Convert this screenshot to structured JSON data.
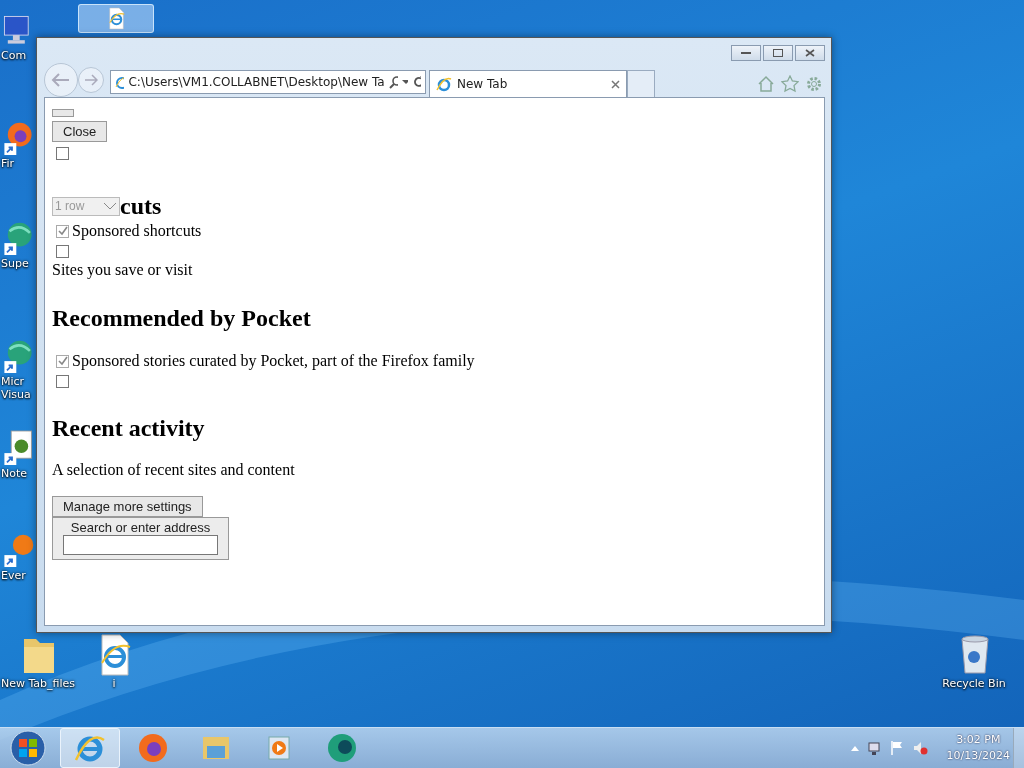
{
  "desktop_icons": [
    {
      "kind": "computer",
      "lines": [
        "Com"
      ],
      "selected": false
    },
    {
      "kind": "iefile",
      "selected": true
    },
    {
      "kind": "firefox",
      "lines": [
        "Fir"
      ],
      "selected": false
    },
    {
      "kind": "globe",
      "lines": [
        "Supe"
      ],
      "selected": false
    },
    {
      "kind": "globe",
      "lines": [
        "Micr",
        "Visua"
      ],
      "selected": false
    },
    {
      "kind": "notepad",
      "lines": [
        "Note"
      ],
      "selected": false
    },
    {
      "kind": "orange",
      "lines": [
        "Ever"
      ],
      "selected": false
    },
    {
      "kind": "folder",
      "lines": [
        "New Tab_files"
      ],
      "selected": false
    },
    {
      "kind": "iefile",
      "lines": [
        "i"
      ],
      "selected": false
    },
    {
      "kind": "recycle",
      "lines": [
        "Recycle Bin"
      ],
      "selected": false
    }
  ],
  "browser": {
    "address": "C:\\Users\\VM1.COLLABNET\\Desktop\\New Ta",
    "tabs": [
      {
        "label": "New Tab",
        "selected": true
      }
    ],
    "page": [
      {
        "kind": "blank-button"
      },
      {
        "kind": "button",
        "label": "Close"
      },
      {
        "kind": "checkbox",
        "checked": false
      },
      {
        "kind": "select-heading",
        "value": "1 row",
        "heading": "cuts"
      },
      {
        "kind": "checkbox",
        "checked": true,
        "label": "Sponsored shortcuts"
      },
      {
        "kind": "checkbox",
        "checked": false
      },
      {
        "kind": "text",
        "text": "Sites you save or visit"
      },
      {
        "kind": "heading",
        "text": "Recommended by Pocket"
      },
      {
        "kind": "checkbox",
        "checked": true,
        "label": "Sponsored stories",
        "after": "curated by Pocket, part of the Firefox family"
      },
      {
        "kind": "checkbox",
        "checked": false
      },
      {
        "kind": "heading",
        "text": "Recent activity"
      },
      {
        "kind": "text",
        "text": "A selection of recent sites and content"
      },
      {
        "kind": "button",
        "label": "Manage more settings"
      },
      {
        "kind": "search",
        "label": "Search or enter address"
      }
    ]
  },
  "taskbar": {
    "items": [
      {
        "kind": "ie",
        "selected": true
      },
      {
        "kind": "firefox",
        "selected": false
      },
      {
        "kind": "explorer",
        "selected": false
      },
      {
        "kind": "media",
        "selected": false
      },
      {
        "kind": "app",
        "selected": false
      }
    ],
    "time": "3:02 PM",
    "date": "10/13/2024"
  }
}
